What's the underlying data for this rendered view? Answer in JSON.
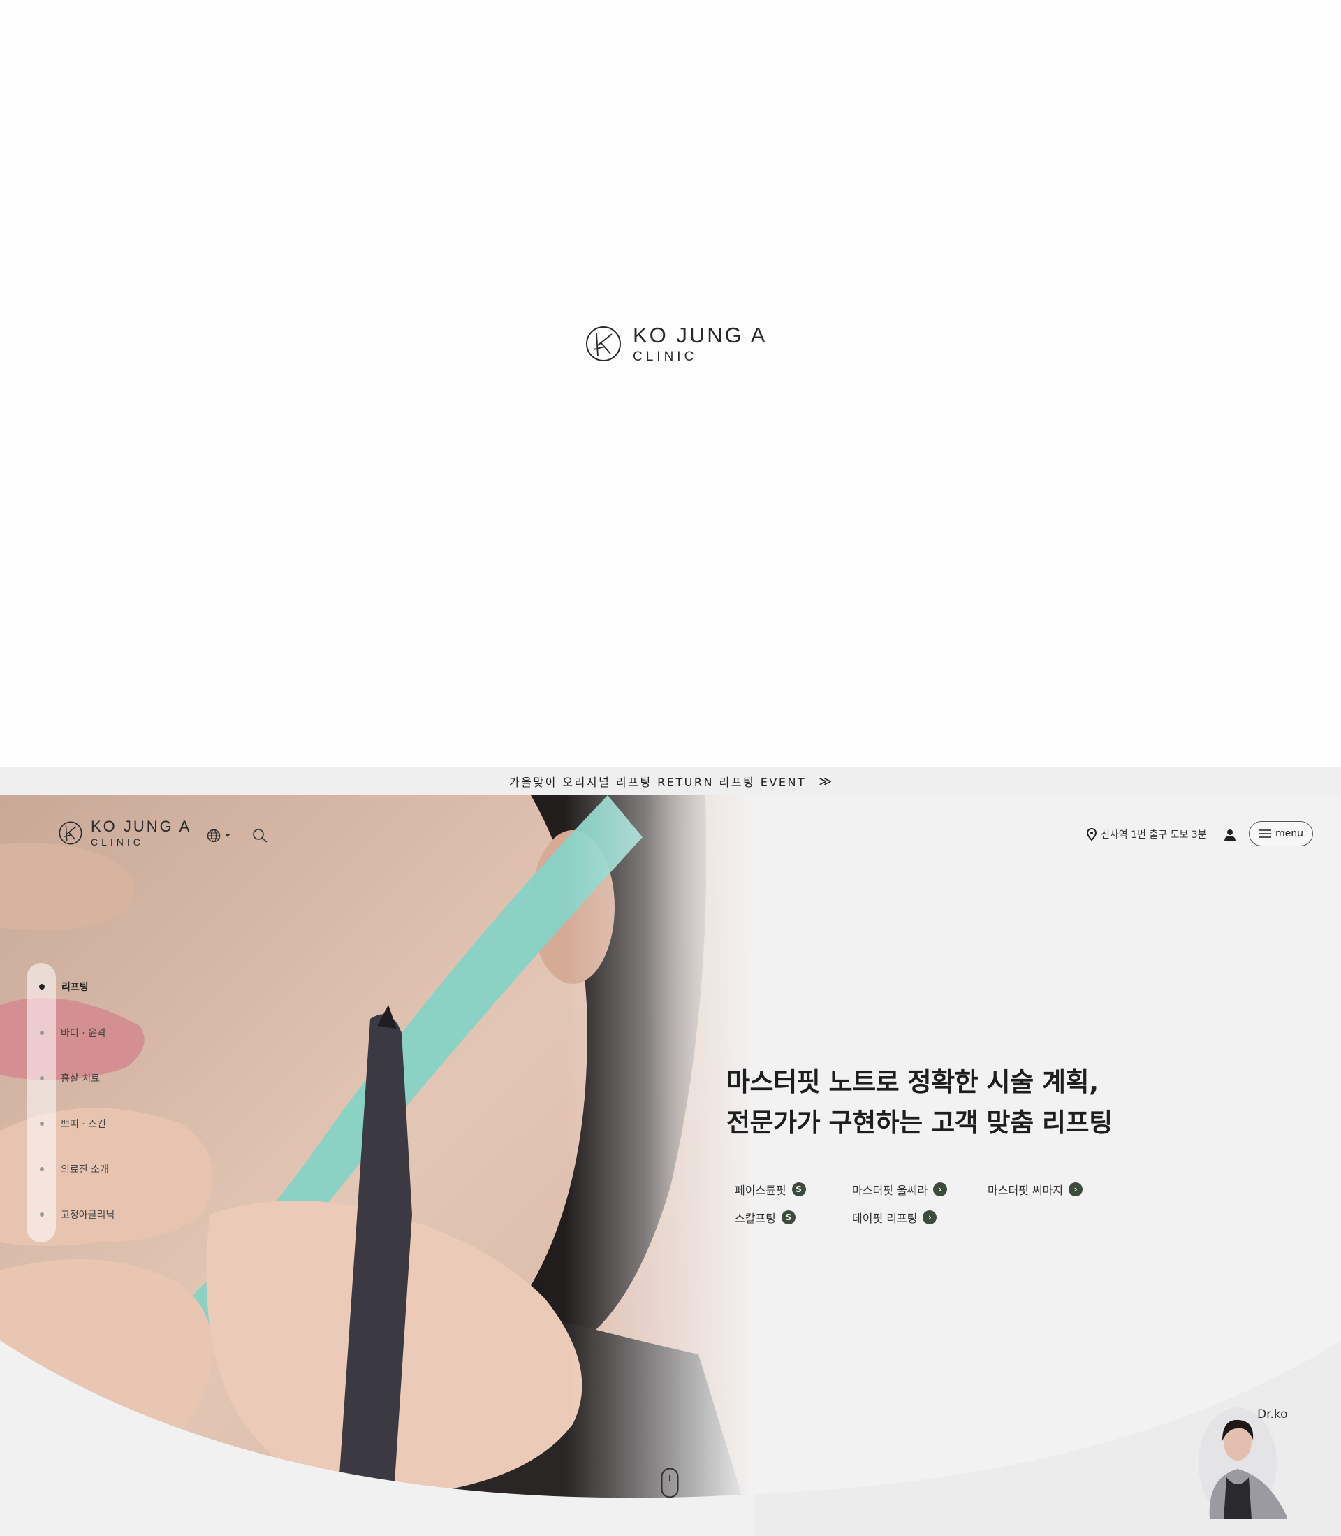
{
  "brand": {
    "name": "KO JUNG A",
    "sub": "CLINIC"
  },
  "event_bar": {
    "text": "가을맞이 오리지널 리프팅 RETURN 리프팅 EVENT",
    "arrow": "≫"
  },
  "header": {
    "location": "신사역 1번 출구 도보 3분",
    "menu_label": "menu",
    "icons": [
      "globe-icon",
      "search-icon",
      "location-pin-icon",
      "user-icon",
      "hamburger-icon"
    ]
  },
  "side_nav": {
    "items": [
      {
        "label": "리프팅",
        "active": true
      },
      {
        "label": "바디 · 윤곽",
        "active": false
      },
      {
        "label": "흉살 치료",
        "active": false
      },
      {
        "label": "쁘띠 · 스킨",
        "active": false
      },
      {
        "label": "의료진 소개",
        "active": false
      },
      {
        "label": "고정아클리닉",
        "active": false
      }
    ]
  },
  "hero": {
    "headline_line1": "마스터핏 노트로 정확한 시술 계획,",
    "headline_line2": "전문가가 구현하는 고객 맞춤 리프팅",
    "treatments": [
      {
        "label": "페이스튠핏",
        "icon": "S"
      },
      {
        "label": "마스터핏 울쎄라",
        "icon": "›"
      },
      {
        "label": "마스터핏 써마지",
        "icon": "›"
      },
      {
        "label": "스칼프팅",
        "icon": "S"
      },
      {
        "label": "데이핏 리프팅",
        "icon": "›"
      }
    ]
  },
  "doctor": {
    "label": "Dr.ko"
  },
  "colors": {
    "accent": "#3d4a3e",
    "background": "#f1f1f1",
    "ruler": "#7fcfc2"
  }
}
